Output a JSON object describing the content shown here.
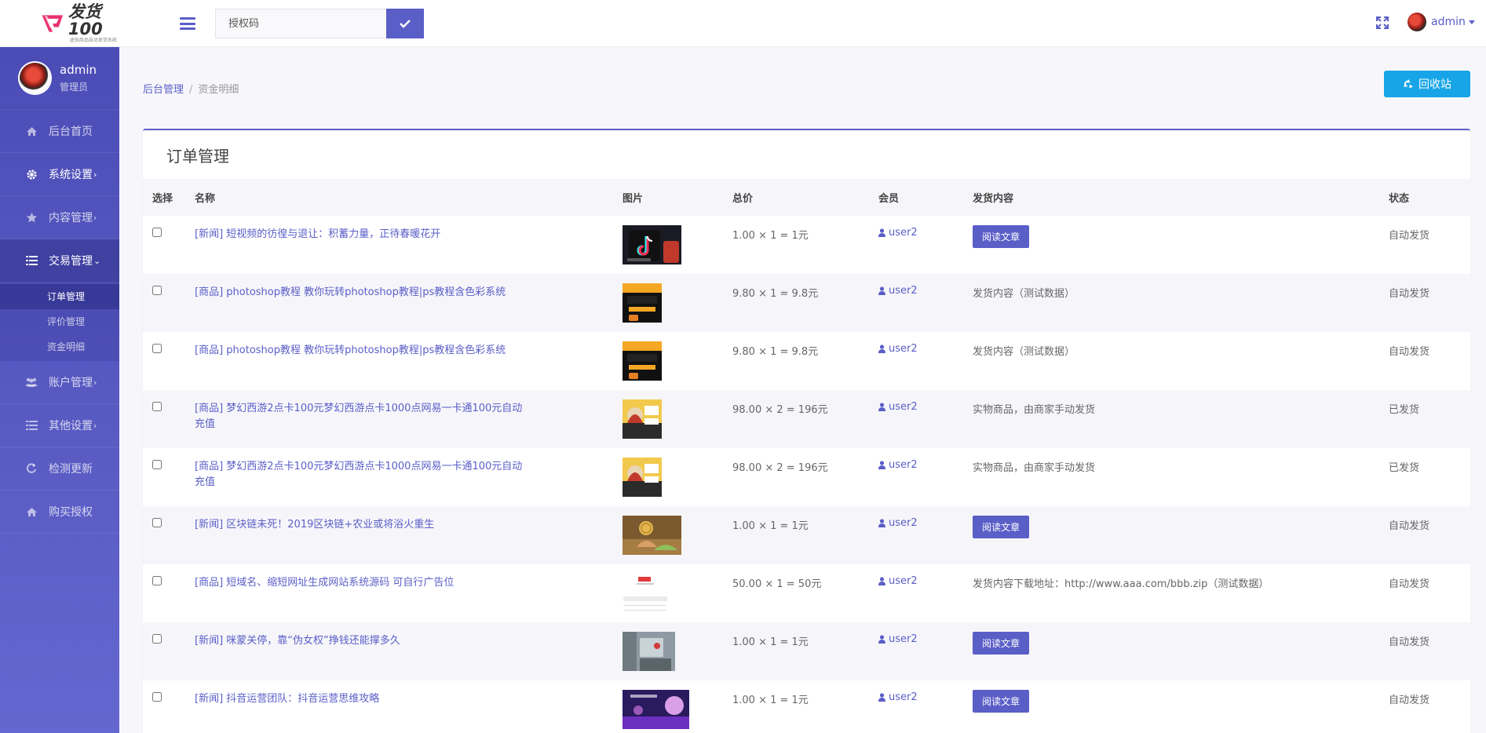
{
  "header": {
    "logo_title": "发货100",
    "logo_subtitle": "虚拟商品自动发货系统",
    "search_placeholder": "授权码",
    "user_name": "admin"
  },
  "sidebar": {
    "profile_name": "admin",
    "profile_role": "管理员",
    "items": [
      {
        "label": "后台首页",
        "icon": "home-icon"
      },
      {
        "label": "系统设置",
        "icon": "gear-icon",
        "arrow": "›"
      },
      {
        "label": "内容管理",
        "icon": "star-icon",
        "arrow": "›"
      },
      {
        "label": "交易管理",
        "icon": "list-icon",
        "arrow": "⌄"
      },
      {
        "label": "账户管理",
        "icon": "users-icon",
        "arrow": "›"
      },
      {
        "label": "其他设置",
        "icon": "list-icon",
        "arrow": "›"
      },
      {
        "label": "检测更新",
        "icon": "refresh-icon"
      },
      {
        "label": "购买授权",
        "icon": "home-icon"
      }
    ],
    "sub_items": [
      "订单管理",
      "评价管理",
      "资金明细"
    ]
  },
  "breadcrumb": {
    "home": "后台管理",
    "current": "资金明细"
  },
  "recycle_label": "回收站",
  "card_title": "订单管理",
  "table": {
    "columns": [
      "选择",
      "名称",
      "图片",
      "总价",
      "会员",
      "发货内容",
      "状态"
    ],
    "read_button_label": "阅读文章",
    "rows": [
      {
        "name": "[新闻] 短视频的彷徨与退让：积蓄力量，正待春暖花开",
        "thumb": "tiktok",
        "total": "1.00 × 1 = 1元",
        "member": "user2",
        "content": "",
        "read": true,
        "status": "自动发货"
      },
      {
        "name": "[商品] photoshop教程 教你玩转photoshop教程|ps教程含色彩系统",
        "thumb": "ps",
        "total": "9.80 × 1 = 9.8元",
        "member": "user2",
        "content": "发货内容（测试数据）",
        "read": false,
        "status": "自动发货"
      },
      {
        "name": "[商品] photoshop教程 教你玩转photoshop教程|ps教程含色彩系统",
        "thumb": "ps",
        "total": "9.80 × 1 = 9.8元",
        "member": "user2",
        "content": "发货内容（测试数据）",
        "read": false,
        "status": "自动发货"
      },
      {
        "name": "[商品] 梦幻西游2点卡100元梦幻西游点卡1000点网易一卡通100元自动充值",
        "thumb": "game",
        "total": "98.00 × 2 = 196元",
        "member": "user2",
        "content": "实物商品，由商家手动发货",
        "read": false,
        "status": "已发货"
      },
      {
        "name": "[商品] 梦幻西游2点卡100元梦幻西游点卡1000点网易一卡通100元自动充值",
        "thumb": "game",
        "total": "98.00 × 2 = 196元",
        "member": "user2",
        "content": "实物商品，由商家手动发货",
        "read": false,
        "status": "已发货"
      },
      {
        "name": "[新闻] 区块链未死！2019区块链+农业或将浴火重生",
        "thumb": "coin",
        "total": "1.00 × 1 = 1元",
        "member": "user2",
        "content": "",
        "read": true,
        "status": "自动发货"
      },
      {
        "name": "[商品] 短域名、缩短网址生成网站系统源码 可自行广告位",
        "thumb": "web",
        "total": "50.00 × 1 = 50元",
        "member": "user2",
        "content": "发货内容下载地址：http://www.aaa.com/bbb.zip（测试数据）",
        "read": false,
        "status": "自动发货"
      },
      {
        "name": "[新闻] 咪蒙关停，靠“伪女权”挣钱还能撑多久",
        "thumb": "room",
        "total": "1.00 × 1 = 1元",
        "member": "user2",
        "content": "",
        "read": true,
        "status": "自动发货"
      },
      {
        "name": "[新闻] 抖音运营团队：抖音运营思维攻略",
        "thumb": "purple",
        "total": "1.00 × 1 = 1元",
        "member": "user2",
        "content": "",
        "read": true,
        "status": "自动发货"
      }
    ]
  }
}
